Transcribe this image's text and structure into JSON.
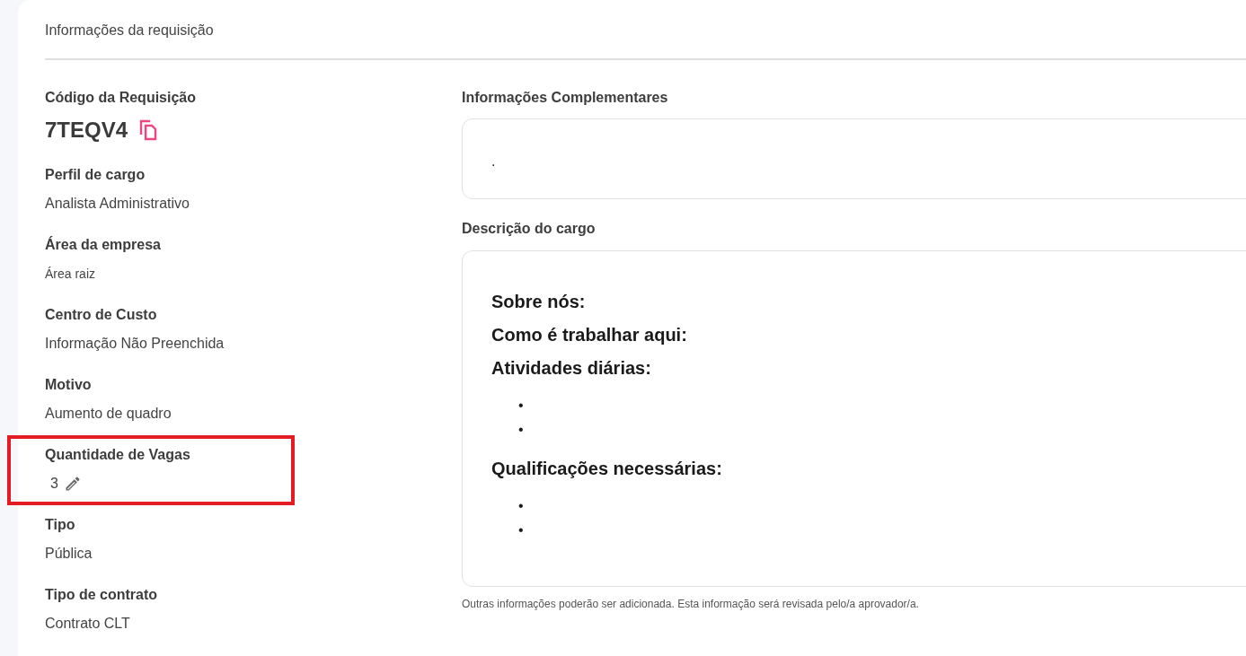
{
  "section_title": "Informações da requisição",
  "fields": [
    {
      "kind": "code",
      "label": "Código da Requisição",
      "value": "7TEQV4",
      "highlighted": false
    },
    {
      "kind": "text",
      "label": "Perfil de cargo",
      "value": "Analista Administrativo",
      "highlighted": false
    },
    {
      "kind": "small",
      "label": "Área da empresa",
      "value": "Área raiz",
      "highlighted": false
    },
    {
      "kind": "text",
      "label": "Centro de Custo",
      "value": "Informação Não Preenchida",
      "highlighted": false
    },
    {
      "kind": "text",
      "label": "Motivo",
      "value": "Aumento de quadro",
      "highlighted": false
    },
    {
      "kind": "editable",
      "label": "Quantidade de Vagas",
      "value": "3",
      "highlighted": true
    },
    {
      "kind": "text",
      "label": "Tipo",
      "value": "Pública",
      "highlighted": false
    },
    {
      "kind": "text",
      "label": "Tipo de contrato",
      "value": "Contrato CLT",
      "highlighted": false
    }
  ],
  "complementary": {
    "label": "Informações Complementares",
    "value": "."
  },
  "description": {
    "label": "Descrição do cargo",
    "sections": [
      {
        "heading": "Sobre nós:"
      },
      {
        "heading": "Como é trabalhar aqui:"
      },
      {
        "heading": "Atividades diárias:",
        "bullets": [
          "•",
          "•"
        ]
      },
      {
        "heading": "Qualificações necessárias:",
        "bullets": [
          "•",
          "•"
        ]
      }
    ]
  },
  "footnote": "Outras informações poderão ser adicionada. Esta informação será revisada pelo/a aprovador/a."
}
